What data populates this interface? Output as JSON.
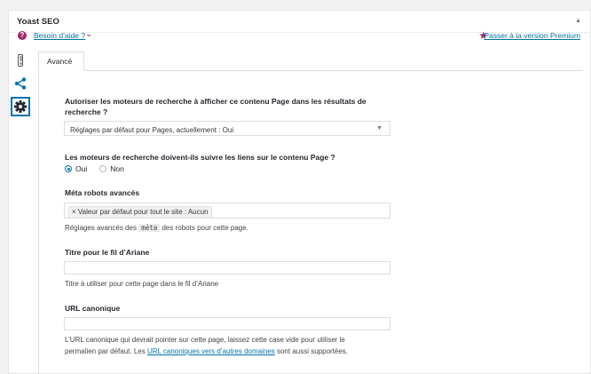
{
  "panel": {
    "title": "Yoast SEO"
  },
  "help": {
    "link": "Besoin d’aide ?",
    "premium_link": "Passer à la version Premium"
  },
  "tabs": {
    "active": "Avancé"
  },
  "icons": {
    "help": "question-circle-icon",
    "chevron": "chevron-down-icon",
    "star": "star-icon",
    "traffic": "traffic-light-icon",
    "share": "share-icon",
    "gear": "gear-icon"
  },
  "colors": {
    "accent": "#a4286a",
    "link": "#0073aa"
  },
  "fields": {
    "allow_index": {
      "label_1": "Autoriser les moteurs de recherche à afficher ce contenu Page dans les résultats de",
      "label_2": "recherche ?",
      "value": "Réglages par défaut pour Pages, actuellement : Oui"
    },
    "follow_links": {
      "label": "Les moteurs de recherche doivent-ils suivre les liens sur le contenu Page ?",
      "options": [
        "Oui",
        "Non"
      ],
      "selected": "Oui"
    },
    "meta_robots": {
      "label": "Méta robots avancés",
      "token": "× Valeur par défaut pour tout le site : Aucun",
      "hint_before": "Réglages avancés des",
      "hint_code": "méta",
      "hint_after": "des robots pour cette page."
    },
    "breadcrumb": {
      "label": "Titre pour le fil d’Ariane",
      "value": "",
      "hint": "Titre à utiliser pour cette page dans le fil d’Ariane"
    },
    "canonical": {
      "label": "URL canonique",
      "value": "",
      "hint_line1": "L’URL canonique qui devrait pointer sur cette page, laissez cette case vide pour utiliser le",
      "hint_line2_before": "permalien par défaut. Les",
      "hint_link": "URL canoniques vers d’autres domaines",
      "hint_line2_after": "sont aussi supportées."
    }
  }
}
